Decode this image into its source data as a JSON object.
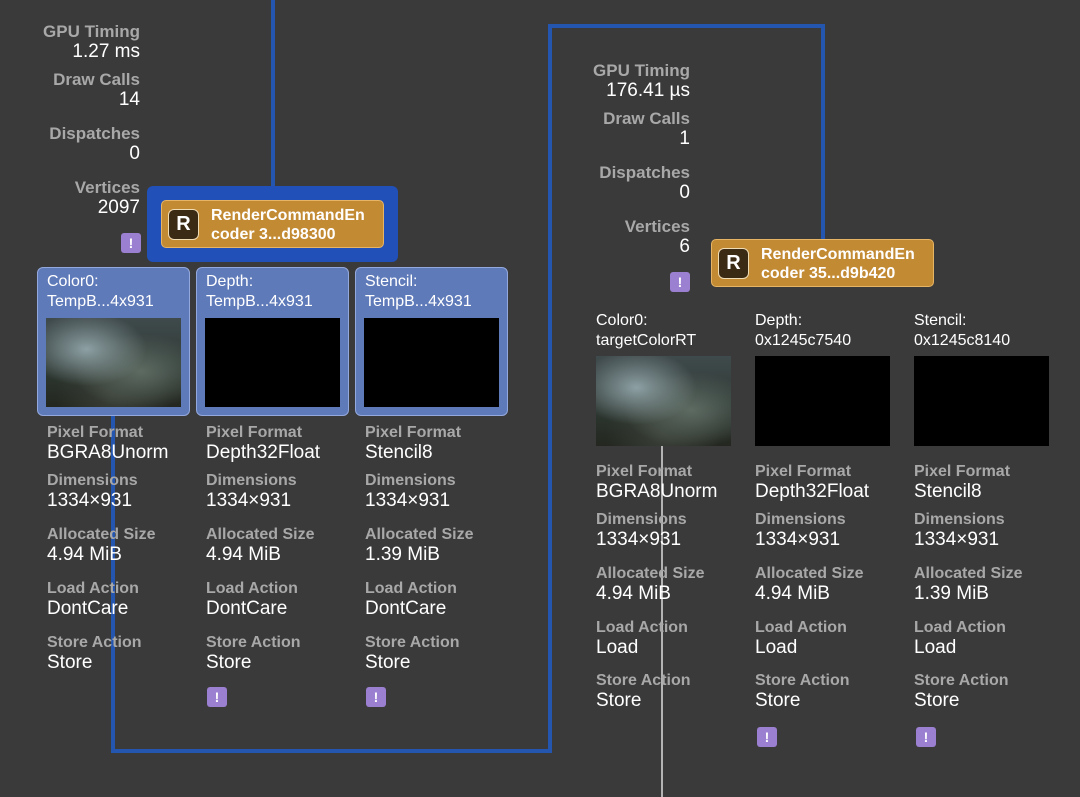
{
  "stat_labels": {
    "gpu_timing": "GPU Timing",
    "draw_calls": "Draw Calls",
    "dispatches": "Dispatches",
    "vertices": "Vertices"
  },
  "prop_labels": {
    "pixel_format": "Pixel Format",
    "dimensions": "Dimensions",
    "allocated_size": "Allocated Size",
    "load_action": "Load Action",
    "store_action": "Store Action"
  },
  "warning_glyph": "!",
  "badge_letter": "R",
  "colors": {
    "background": "#3a3a3a",
    "connector": "#2456b0",
    "selected_frame": "#2050b8",
    "encoder": "#c38a34",
    "attachment_card": "#5f7ab9",
    "warning": "#9b7fd1",
    "secondary_connector": "#b4b4b4"
  },
  "pass1": {
    "stats": {
      "gpu_timing": "1.27 ms",
      "draw_calls": "14",
      "dispatches": "0",
      "vertices": "2097"
    },
    "encoder": {
      "line1": "RenderCommandEn",
      "line2": "coder 3...d98300"
    },
    "attachments": [
      {
        "title1": "Color0:",
        "title2": "TempB...4x931",
        "pixel_format": "BGRA8Unorm",
        "dimensions": "1334×931",
        "allocated_size": "4.94 MiB",
        "load_action": "DontCare",
        "store_action": "Store"
      },
      {
        "title1": "Depth:",
        "title2": "TempB...4x931",
        "pixel_format": "Depth32Float",
        "dimensions": "1334×931",
        "allocated_size": "4.94 MiB",
        "load_action": "DontCare",
        "store_action": "Store"
      },
      {
        "title1": "Stencil:",
        "title2": "TempB...4x931",
        "pixel_format": "Stencil8",
        "dimensions": "1334×931",
        "allocated_size": "1.39 MiB",
        "load_action": "DontCare",
        "store_action": "Store"
      }
    ]
  },
  "pass2": {
    "stats": {
      "gpu_timing": "176.41 µs",
      "draw_calls": "1",
      "dispatches": "0",
      "vertices": "6"
    },
    "encoder": {
      "line1": "RenderCommandEn",
      "line2": "coder 35...d9b420"
    },
    "attachments": [
      {
        "title1": "Color0:",
        "title2": "targetColorRT",
        "pixel_format": "BGRA8Unorm",
        "dimensions": "1334×931",
        "allocated_size": "4.94 MiB",
        "load_action": "Load",
        "store_action": "Store"
      },
      {
        "title1": "Depth:",
        "title2": "0x1245c7540",
        "pixel_format": "Depth32Float",
        "dimensions": "1334×931",
        "allocated_size": "4.94 MiB",
        "load_action": "Load",
        "store_action": "Store"
      },
      {
        "title1": "Stencil:",
        "title2": "0x1245c8140",
        "pixel_format": "Stencil8",
        "dimensions": "1334×931",
        "allocated_size": "1.39 MiB",
        "load_action": "Load",
        "store_action": "Store"
      }
    ]
  }
}
